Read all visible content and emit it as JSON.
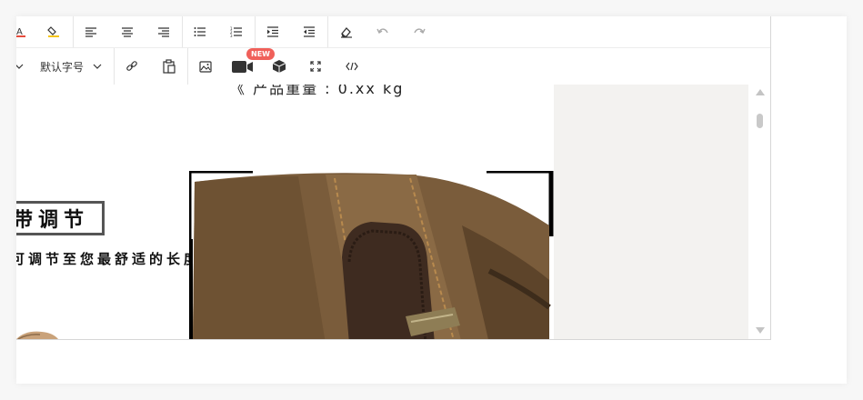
{
  "toolbar": {
    "font_size_label": "默认字号",
    "new_badge": "NEW"
  },
  "content": {
    "top_cut_text": "《 产品重量 : 0.xx kg",
    "section_title": "带调节",
    "section_subtitle": "可调节至您最舒适的长度"
  },
  "colors": {
    "badge": "#f0605a",
    "right_pane": "#f3f2f0",
    "canvas_brown": "#7a5c3b",
    "leather": "#3e2b20"
  }
}
